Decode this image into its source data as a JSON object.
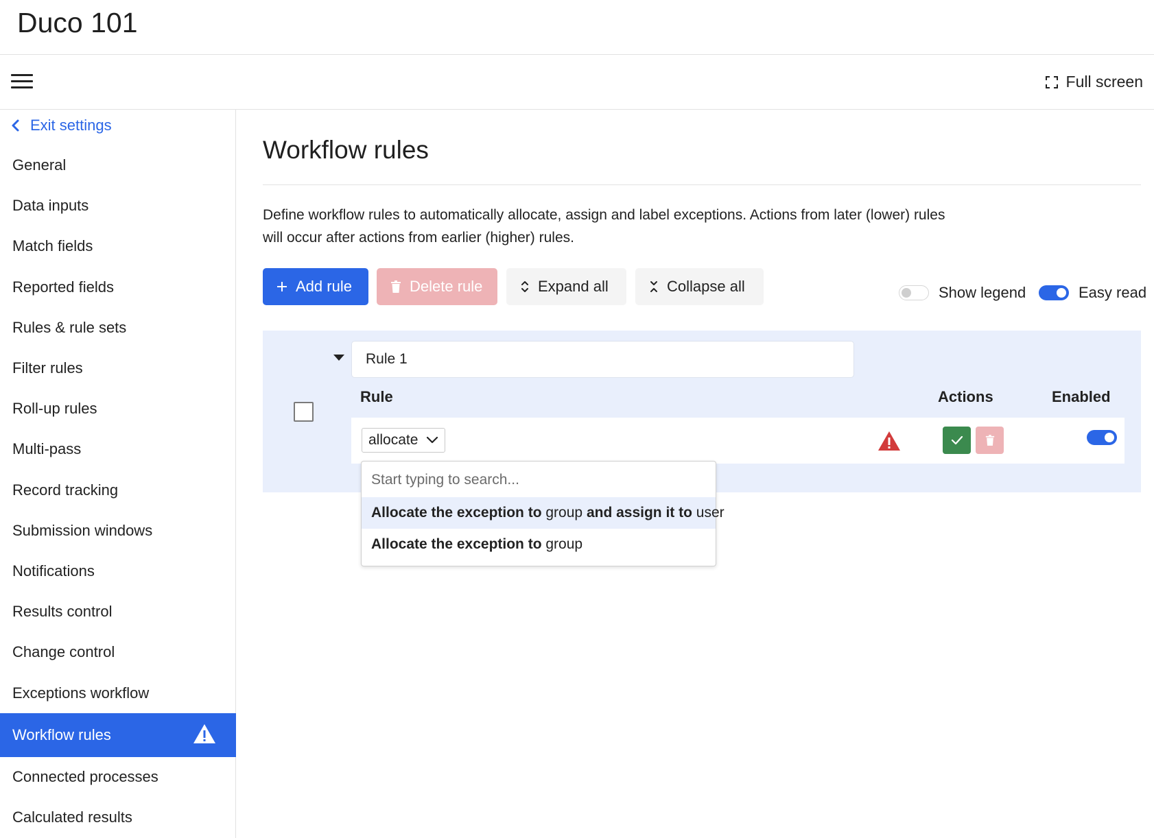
{
  "app": {
    "title": "Duco 101"
  },
  "toolbar": {
    "fullscreen_label": "Full screen"
  },
  "sidebar": {
    "exit_label": "Exit settings",
    "items": [
      {
        "label": "General"
      },
      {
        "label": "Data inputs"
      },
      {
        "label": "Match fields"
      },
      {
        "label": "Reported fields"
      },
      {
        "label": "Rules & rule sets"
      },
      {
        "label": "Filter rules"
      },
      {
        "label": "Roll-up rules"
      },
      {
        "label": "Multi-pass"
      },
      {
        "label": "Record tracking"
      },
      {
        "label": "Submission windows"
      },
      {
        "label": "Notifications"
      },
      {
        "label": "Results control"
      },
      {
        "label": "Change control"
      },
      {
        "label": "Exceptions workflow"
      },
      {
        "label": "Workflow rules",
        "active": true,
        "warning": true
      },
      {
        "label": "Connected processes"
      },
      {
        "label": "Calculated results"
      }
    ]
  },
  "main": {
    "title": "Workflow rules",
    "description_line1": "Define workflow rules to automatically allocate, assign and label exceptions. Actions from later (lower) rules",
    "description_line2": "will occur after actions from earlier (higher) rules.",
    "buttons": {
      "add": "Add rule",
      "delete": "Delete rule",
      "expand": "Expand all",
      "collapse": "Collapse all"
    },
    "toggles": {
      "show_legend": {
        "label": "Show legend",
        "on": false
      },
      "easy_read": {
        "label": "Easy read",
        "on": true
      }
    },
    "rule": {
      "name": "Rule 1",
      "headers": {
        "rule": "Rule",
        "actions": "Actions",
        "enabled": "Enabled"
      },
      "select_value": "allocate",
      "enabled": true
    },
    "dropdown": {
      "placeholder": "Start typing to search...",
      "options": [
        {
          "b1": "Allocate the exception to",
          "t1": " group ",
          "b2": "and assign it to",
          "t2": " user"
        },
        {
          "b1": "Allocate the exception to",
          "t1": " group"
        }
      ]
    }
  },
  "colors": {
    "accent": "#2b66e6",
    "delete_bg": "#eeb3b6",
    "success": "#3b8a4e",
    "warning_red": "#d23b3b",
    "panel_bg": "#e9effc"
  }
}
